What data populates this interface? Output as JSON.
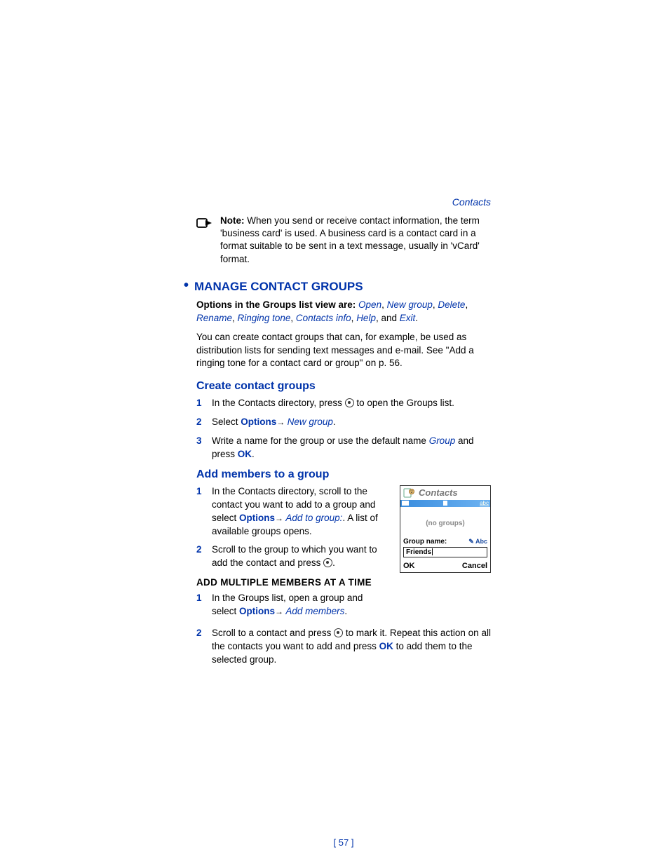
{
  "header": "Contacts",
  "note": {
    "label": "Note:",
    "text": " When you send or receive contact information, the term 'business card' is used. A business card is a contact card in a format suitable to be sent in a text message, usually in 'vCard' format."
  },
  "h1": "MANAGE CONTACT GROUPS",
  "options_prefix": "Options in the Groups list view are: ",
  "options": {
    "open": "Open",
    "new_group": "New group",
    "delete": "Delete",
    "rename": "Rename",
    "ringing_tone": "Ringing tone",
    "contacts_info": "Contacts info",
    "help": "Help",
    "exit": "Exit"
  },
  "options_tail": ", and ",
  "intro_para": "You can create contact groups that can, for example, be used as distribution lists for sending text messages and e-mail. See \"Add a ringing tone for a contact card or group\" on p. 56.",
  "h2a": "Create contact groups",
  "create_steps": [
    {
      "n": "1",
      "pre": "In the Contacts directory, press ",
      "post": " to open the Groups list.",
      "has_icon": true
    },
    {
      "n": "2",
      "pre": "Select ",
      "opt": "Options",
      "arrow": "→ ",
      "italic": "New group",
      "post2": "."
    },
    {
      "n": "3",
      "pre": "Write a name for the group or use the default name ",
      "italic": "Group",
      "post": " and press ",
      "ok": "OK",
      "post2": "."
    }
  ],
  "h2b": "Add members to a group",
  "add_steps": [
    {
      "n": "1",
      "pre": "In the Contacts directory, scroll to the contact you want to add to a group and select ",
      "opt": "Options",
      "arrow": "→ ",
      "italic": "Add to group:",
      "post2": ". A list of available groups opens."
    },
    {
      "n": "2",
      "pre": "Scroll to the group to which you want to add the contact and press ",
      "has_icon": true,
      "post2": "."
    }
  ],
  "h3": "ADD MULTIPLE MEMBERS AT A TIME",
  "multi_steps": [
    {
      "n": "1",
      "pre": "In the Groups list, open a group and select ",
      "opt": "Options",
      "arrow": "→ ",
      "italic": "Add members",
      "post2": "."
    },
    {
      "n": "2",
      "pre": "Scroll to a contact and press ",
      "has_icon": true,
      "mid": " to mark it. Repeat this action on all the contacts you want to add and press ",
      "ok": "OK",
      "post2": " to add them to the selected group."
    }
  ],
  "phone": {
    "title": "Contacts",
    "bar_right": "abc",
    "mid": "(no groups)",
    "label": "Group name:",
    "indicator": "✎ Abc",
    "input": "Friends",
    "left_soft": "OK",
    "right_soft": "Cancel"
  },
  "page_num": "[ 57 ]"
}
